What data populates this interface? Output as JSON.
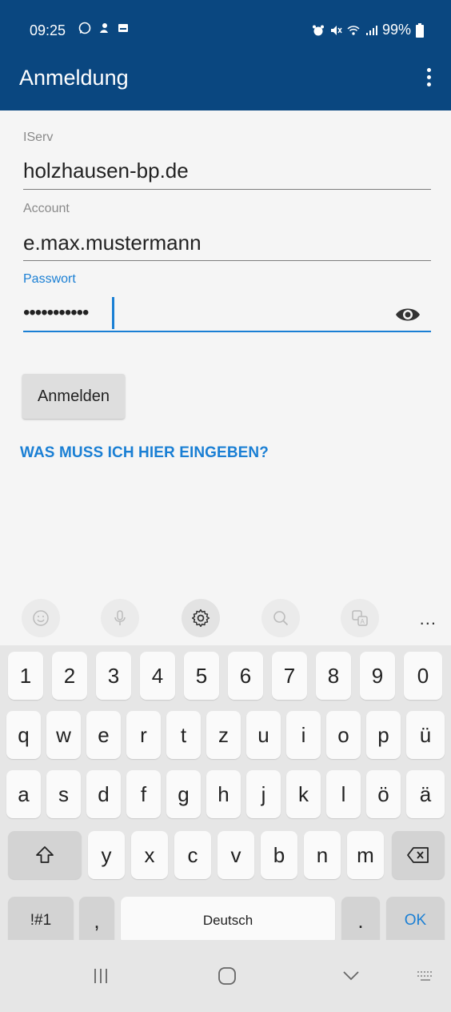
{
  "status_bar": {
    "time": "09:25",
    "battery": "99%",
    "left_icons": [
      "whatsapp-icon",
      "notification-icon",
      "message-icon"
    ],
    "right_icons": [
      "alarm-icon",
      "mute-icon",
      "wifi-icon",
      "signal-icon",
      "battery-icon"
    ]
  },
  "toolbar": {
    "title": "Anmeldung",
    "menu_icon": "more-vert-icon"
  },
  "form": {
    "iserv_label": "IServ",
    "iserv_value": "holzhausen-bp.de",
    "account_label": "Account",
    "account_value": "e.max.mustermann",
    "password_label": "Passwort",
    "password_value": "•••••••••••",
    "visibility_icon": "eye-icon"
  },
  "login_button": "Anmelden",
  "help_link": "WAS MUSS ICH HIER EINGEBEN?",
  "keyboard_toolbar": {
    "icons": [
      "emoji-icon",
      "microphone-icon",
      "settings-icon",
      "search-icon",
      "translate-icon"
    ],
    "more": "..."
  },
  "keyboard": {
    "row_numbers": [
      "1",
      "2",
      "3",
      "4",
      "5",
      "6",
      "7",
      "8",
      "9",
      "0"
    ],
    "row1": [
      "q",
      "w",
      "e",
      "r",
      "t",
      "z",
      "u",
      "i",
      "o",
      "p",
      "ü"
    ],
    "row2": [
      "a",
      "s",
      "d",
      "f",
      "g",
      "h",
      "j",
      "k",
      "l",
      "ö",
      "ä"
    ],
    "row3": [
      "y",
      "x",
      "c",
      "v",
      "b",
      "n",
      "m"
    ],
    "shift_icon": "shift-icon",
    "backspace_icon": "backspace-icon",
    "symbols": "!#1",
    "comma": ",",
    "space": "Deutsch",
    "period": ".",
    "ok": "OK"
  },
  "nav_bar": {
    "icons": [
      "recent-apps-icon",
      "home-icon",
      "back-icon",
      "keyboard-icon"
    ]
  },
  "colors": {
    "app_bar": "#0a4780",
    "accent": "#1a7fd4",
    "background": "#f5f5f5",
    "keyboard_bg": "#e6e6e6"
  }
}
